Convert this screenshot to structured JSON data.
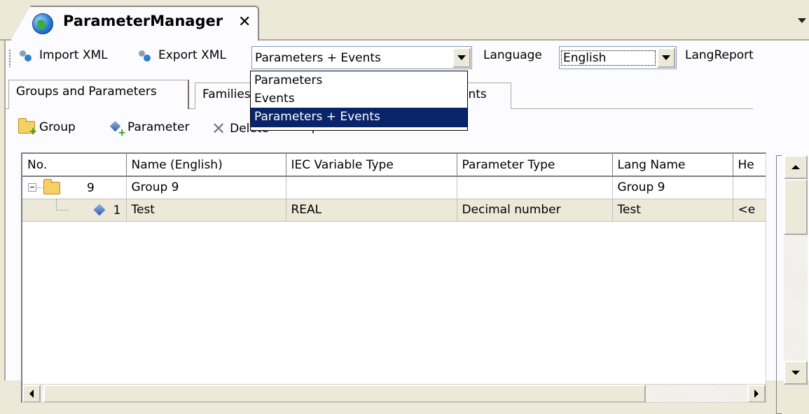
{
  "document_tab": {
    "title": "ParameterManager",
    "close_glyph": "✕"
  },
  "toolbar": {
    "import_label": "Import XML",
    "export_label": "Export XML",
    "filter_selected": "Parameters + Events",
    "filter_options": [
      "Parameters",
      "Events",
      "Parameters + Events"
    ],
    "language_label": "Language",
    "language_selected": "English",
    "langreport_label": "LangReport"
  },
  "inner_tabs": {
    "tab1": "Groups and Parameters",
    "tab2": "Families",
    "tab3": "ents"
  },
  "subtoolbar": {
    "group_label": "Group",
    "parameter_label": "Parameter",
    "delete_label": "Delete",
    "expand_all_label": "Expand all"
  },
  "grid": {
    "columns": [
      "No.",
      "Name (English)",
      "IEC Variable Type",
      "Parameter Type",
      "Lang Name",
      "He"
    ],
    "rows": [
      {
        "no": "9",
        "name": "Group 9",
        "iec": "",
        "ptype": "",
        "lang": "Group 9",
        "help": ""
      },
      {
        "no": "1",
        "name": "Test",
        "iec": "REAL",
        "ptype": "Decimal number",
        "lang": "Test",
        "help": "<e"
      }
    ]
  },
  "colors": {
    "selection": "#0a246a",
    "chrome": "#ece9d8",
    "row_selected": "#ece9d8"
  }
}
